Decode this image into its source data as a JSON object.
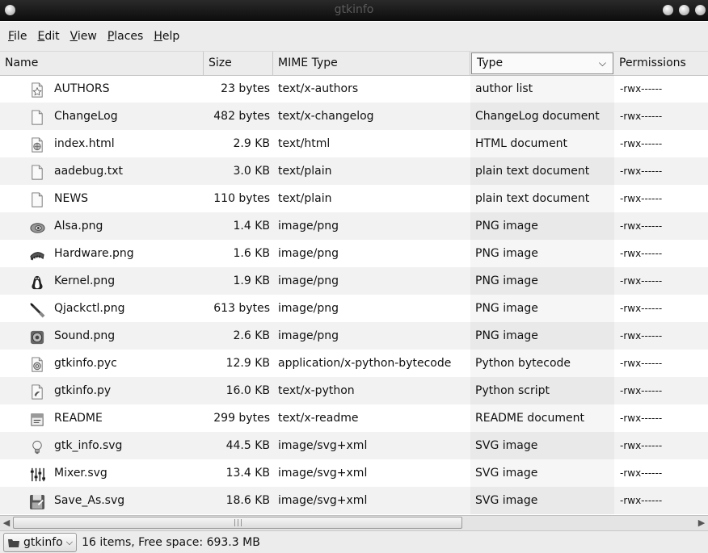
{
  "window": {
    "title": "gtkinfo"
  },
  "menu": [
    {
      "mnemonic": "F",
      "rest": "ile"
    },
    {
      "mnemonic": "E",
      "rest": "dit"
    },
    {
      "mnemonic": "V",
      "rest": "iew"
    },
    {
      "mnemonic": "P",
      "rest": "laces"
    },
    {
      "mnemonic": "H",
      "rest": "elp"
    }
  ],
  "columns": {
    "name": "Name",
    "size": "Size",
    "mime": "MIME Type",
    "type": "Type",
    "permissions": "Permissions"
  },
  "files": [
    {
      "name": "AUTHORS",
      "size": "23 bytes",
      "mime": "text/x-authors",
      "type": "author list",
      "perm": "-rwx------",
      "icon": "star-document-icon"
    },
    {
      "name": "ChangeLog",
      "size": "482 bytes",
      "mime": "text/x-changelog",
      "type": "ChangeLog document",
      "perm": "-rwx------",
      "icon": "document-icon"
    },
    {
      "name": "index.html",
      "size": "2.9 KB",
      "mime": "text/html",
      "type": "HTML document",
      "perm": "-rwx------",
      "icon": "web-document-icon"
    },
    {
      "name": "aadebug.txt",
      "size": "3.0 KB",
      "mime": "text/plain",
      "type": "plain text document",
      "perm": "-rwx------",
      "icon": "document-icon"
    },
    {
      "name": "NEWS",
      "size": "110 bytes",
      "mime": "text/plain",
      "type": "plain text document",
      "perm": "-rwx------",
      "icon": "document-icon"
    },
    {
      "name": "Alsa.png",
      "size": "1.4 KB",
      "mime": "image/png",
      "type": "PNG image",
      "perm": "-rwx------",
      "icon": "speaker-icon"
    },
    {
      "name": "Hardware.png",
      "size": "1.6 KB",
      "mime": "image/png",
      "type": "PNG image",
      "perm": "-rwx------",
      "icon": "chip-icon"
    },
    {
      "name": "Kernel.png",
      "size": "1.9 KB",
      "mime": "image/png",
      "type": "PNG image",
      "perm": "-rwx------",
      "icon": "penguin-icon"
    },
    {
      "name": "Qjackctl.png",
      "size": "613 bytes",
      "mime": "image/png",
      "type": "PNG image",
      "perm": "-rwx------",
      "icon": "jack-plug-icon"
    },
    {
      "name": "Sound.png",
      "size": "2.6 KB",
      "mime": "image/png",
      "type": "PNG image",
      "perm": "-rwx------",
      "icon": "sound-icon"
    },
    {
      "name": "gtkinfo.pyc",
      "size": "12.9 KB",
      "mime": "application/x-python-bytecode",
      "type": "Python bytecode",
      "perm": "-rwx------",
      "icon": "python-bytecode-icon"
    },
    {
      "name": "gtkinfo.py",
      "size": "16.0 KB",
      "mime": "text/x-python",
      "type": "Python script",
      "perm": "-rwx------",
      "icon": "python-script-icon"
    },
    {
      "name": "README",
      "size": "299 bytes",
      "mime": "text/x-readme",
      "type": "README document",
      "perm": "-rwx------",
      "icon": "readme-icon"
    },
    {
      "name": "gtk_info.svg",
      "size": "44.5 KB",
      "mime": "image/svg+xml",
      "type": "SVG image",
      "perm": "-rwx------",
      "icon": "lightbulb-icon"
    },
    {
      "name": "Mixer.svg",
      "size": "13.4 KB",
      "mime": "image/svg+xml",
      "type": "SVG image",
      "perm": "-rwx------",
      "icon": "mixer-icon"
    },
    {
      "name": "Save_As.svg",
      "size": "18.6 KB",
      "mime": "image/svg+xml",
      "type": "SVG image",
      "perm": "-rwx------",
      "icon": "save-as-icon"
    }
  ],
  "statusbar": {
    "location": "gtkinfo",
    "text": "16 items, Free space: 693.3 MB"
  }
}
